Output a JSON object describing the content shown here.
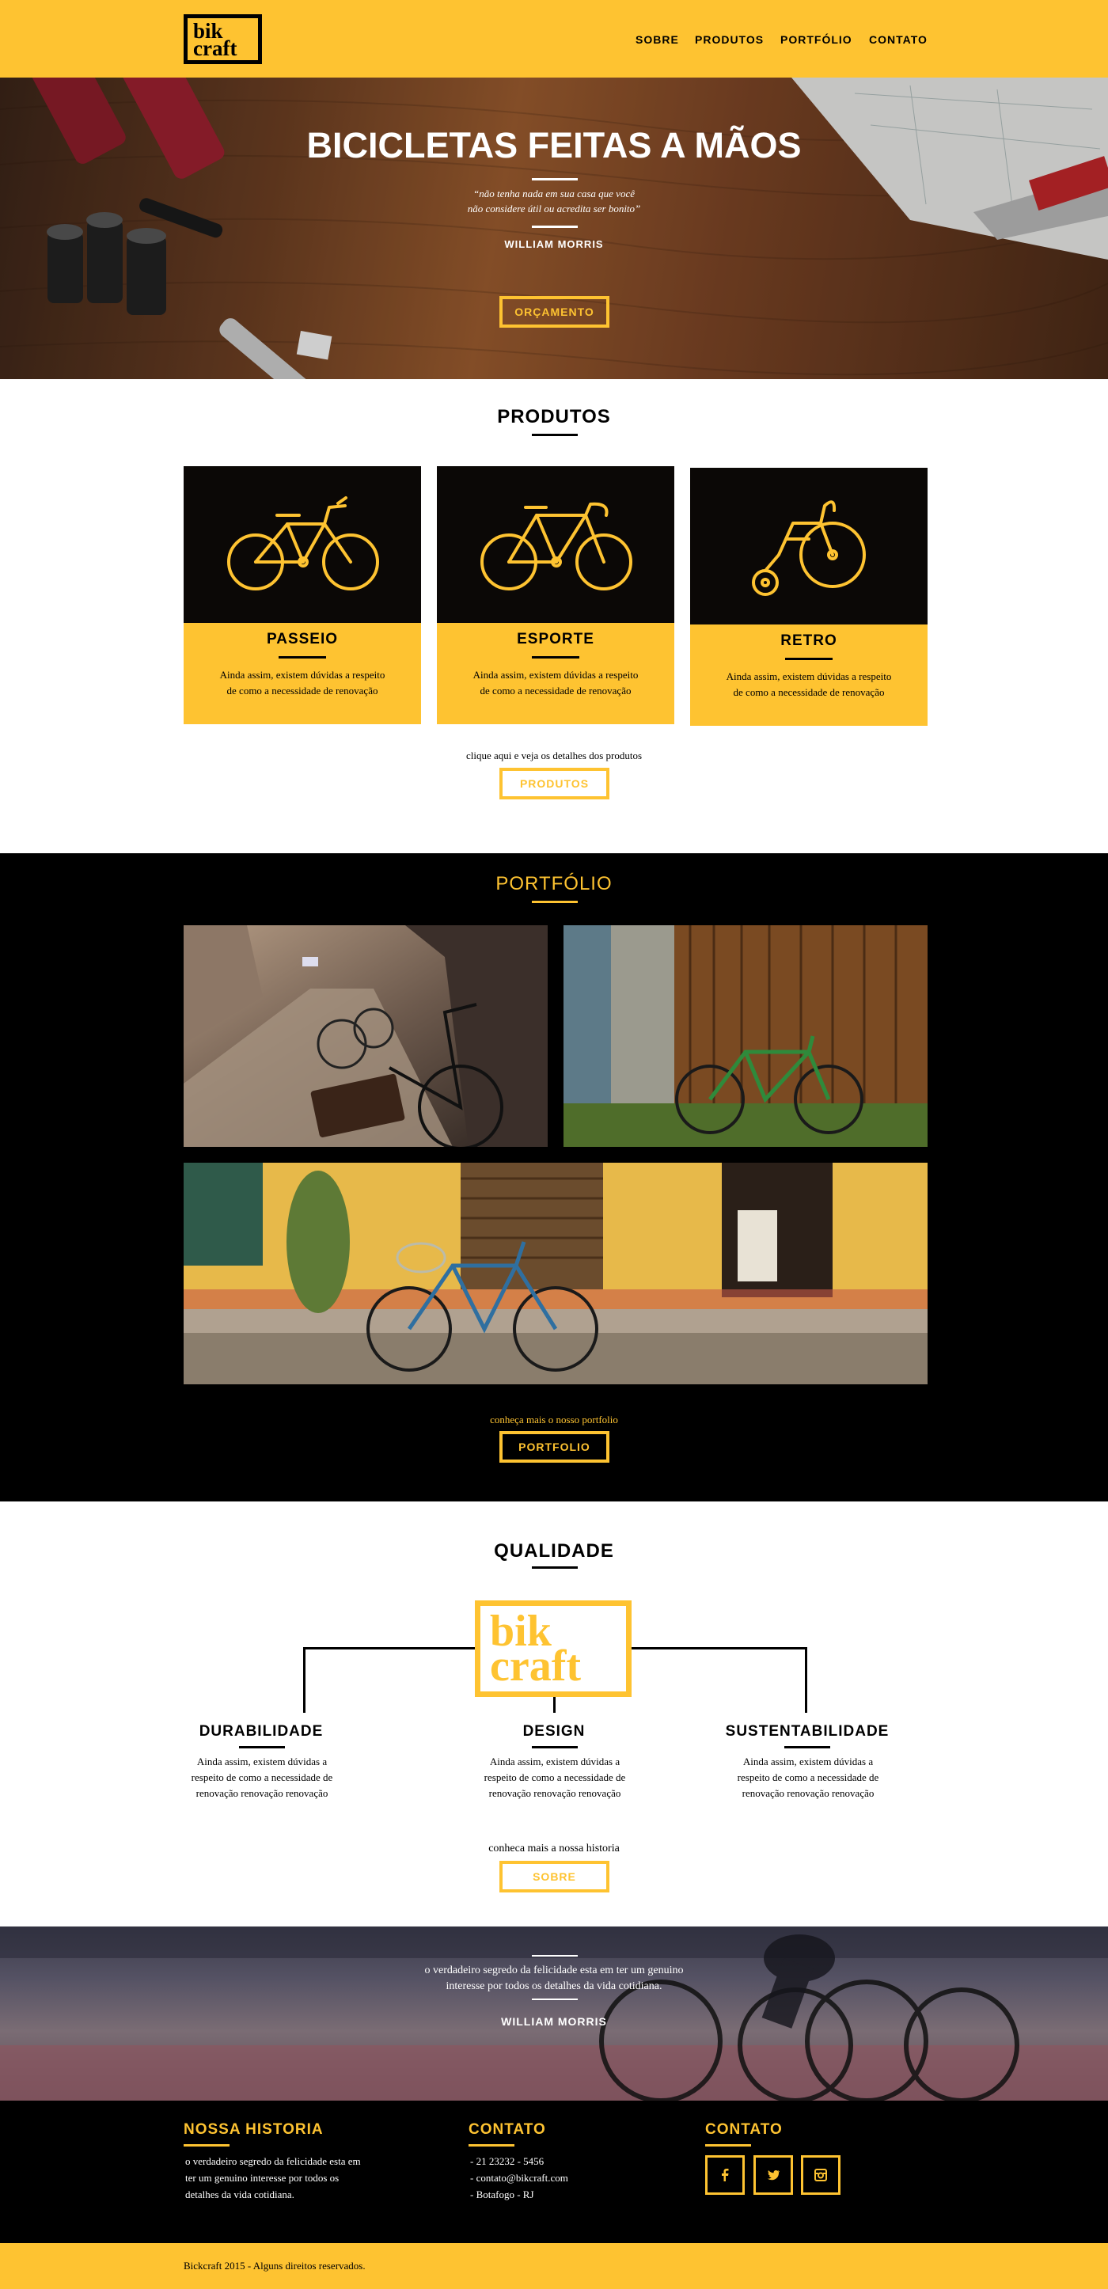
{
  "header": {
    "logo_line1": "bik",
    "logo_line2": "craft",
    "nav": [
      "SOBRE",
      "PRODUTOS",
      "PORTFÓLIO",
      "CONTATO"
    ]
  },
  "hero": {
    "title": "BICICLETAS FEITAS A MÃOS",
    "quote_line1": "“não tenha nada em sua casa que você",
    "quote_line2": "não considere útil ou acredita ser bonito”",
    "author": "WILLIAM MORRIS",
    "button": "ORÇAMENTO"
  },
  "products": {
    "heading": "PRODUTOS",
    "items": [
      {
        "name": "PASSEIO",
        "desc_line1": "Ainda assim, existem dúvidas a respeito",
        "desc_line2": "de como a necessidade de renovação",
        "icon": "city-bike-icon"
      },
      {
        "name": "ESPORTE",
        "desc_line1": "Ainda assim, existem dúvidas a respeito",
        "desc_line2": "de como a necessidade de renovação",
        "icon": "sport-bike-icon"
      },
      {
        "name": "RETRO",
        "desc_line1": "Ainda assim, existem dúvidas a respeito",
        "desc_line2": "de como a necessidade de renovação",
        "icon": "penny-farthing-icon"
      }
    ],
    "cta_text": "clique aqui e veja os detalhes dos produtos",
    "button": "PRODUTOS"
  },
  "portfolio": {
    "heading": "PORTFÓLIO",
    "cta_text": "conheça mais o nosso portfolio",
    "button": "PORTFOLIO"
  },
  "quality": {
    "heading": "QUALIDADE",
    "logo_line1": "bik",
    "logo_line2": "craft",
    "items": [
      {
        "name": "DURABILIDADE",
        "l1": "Ainda assim, existem dúvidas a",
        "l2": "respeito de como a necessidade de",
        "l3": "renovação renovação renovação"
      },
      {
        "name": "DESIGN",
        "l1": "Ainda assim, existem dúvidas a",
        "l2": "respeito de como a necessidade de",
        "l3": "renovação renovação renovação"
      },
      {
        "name": "SUSTENTABILIDADE",
        "l1": "Ainda assim, existem dúvidas a",
        "l2": "respeito de como a necessidade de",
        "l3": "renovação renovação renovação"
      }
    ],
    "cta_text": "conheca mais a nossa historia",
    "button": "SOBRE"
  },
  "quote": {
    "line1": "o verdadeiro segredo da felicidade esta em ter um genuino",
    "line2": "interesse por todos os detalhes da vida cotidiana.",
    "author": "WILLIAM MORRIS"
  },
  "footer": {
    "history_title": "NOSSA HISTORIA",
    "history_l1": "o verdadeiro segredo da felicidade esta em",
    "history_l2": "ter um genuino interesse por todos os",
    "history_l3": "detalhes da vida cotidiana.",
    "contact_title": "CONTATO",
    "phone": "- 21 23232 - 5456",
    "email": "- contato@bikcraft.com",
    "address": "- Botafogo - RJ",
    "social_title": "CONTATO",
    "social_icons": [
      "facebook-icon",
      "twitter-icon",
      "instagram-icon"
    ],
    "copyright": "Bickcraft 2015 - Alguns direitos reservados."
  },
  "colors": {
    "accent": "#FEC331",
    "dark": "#000000"
  }
}
